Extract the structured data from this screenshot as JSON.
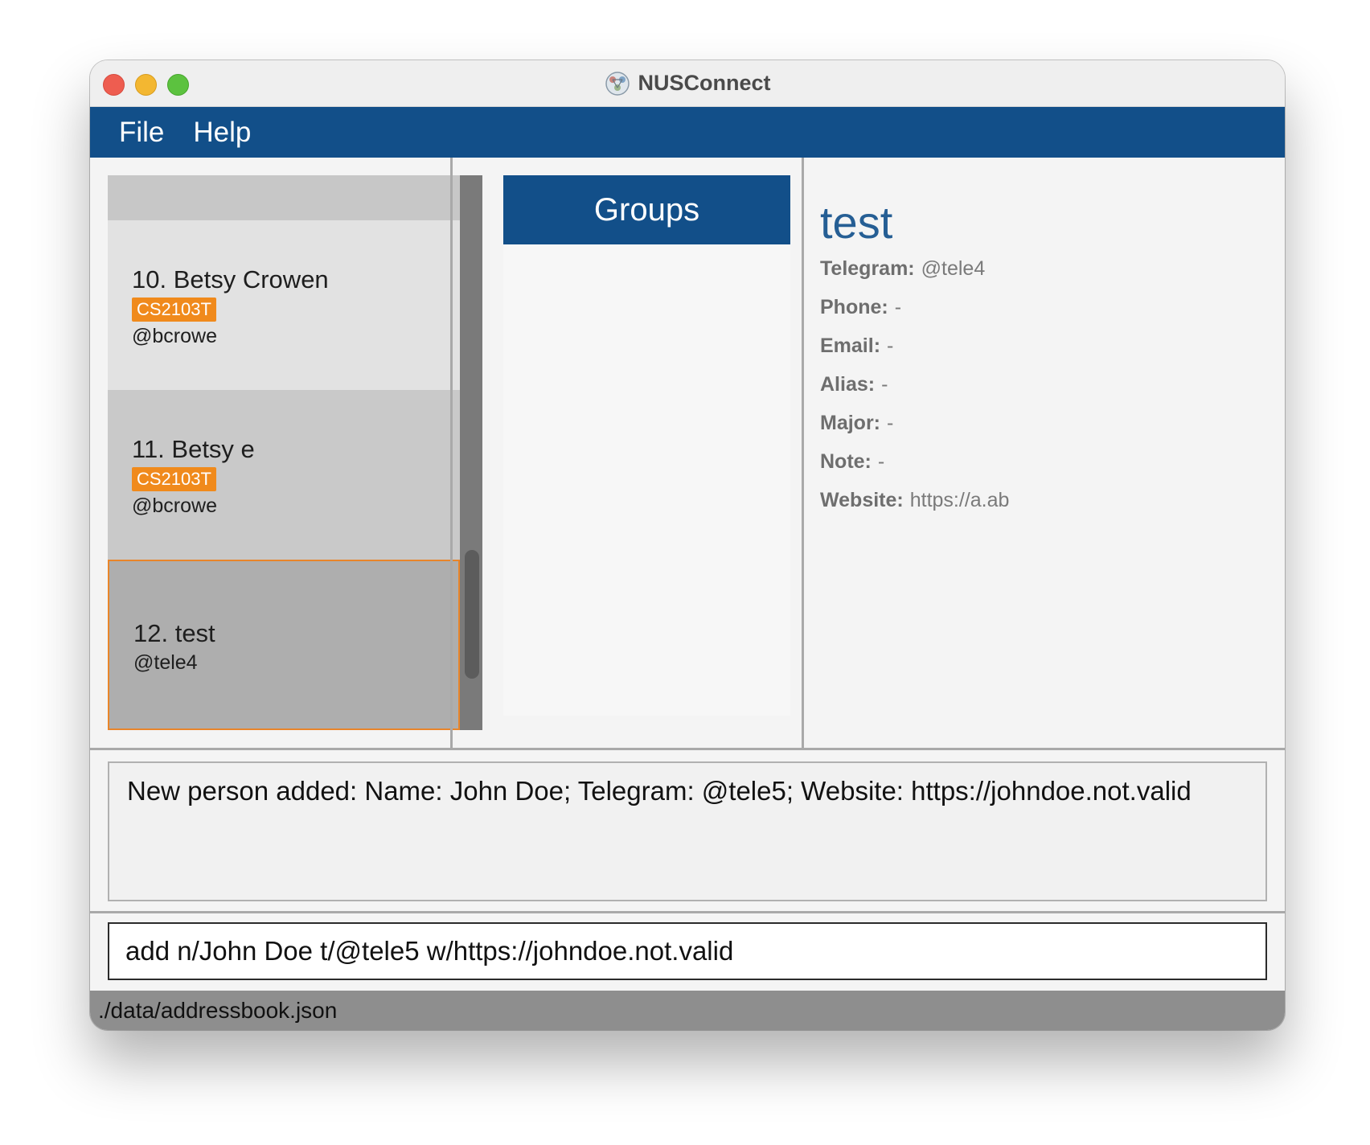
{
  "window": {
    "title": "NUSConnect"
  },
  "menu": {
    "items": [
      "File",
      "Help"
    ]
  },
  "person_list": [
    {
      "name": "10. Betsy Crowen",
      "tag": "CS2103T",
      "handle": "@bcrowe"
    },
    {
      "name": "11. Betsy e",
      "tag": "CS2103T",
      "handle": "@bcrowe"
    },
    {
      "name": "12. test",
      "handle": "@tele4",
      "selected": true
    }
  ],
  "groups": {
    "header": "Groups"
  },
  "details": {
    "name": "test",
    "rows": [
      {
        "label": "Telegram:",
        "value": "@tele4"
      },
      {
        "label": "Phone:",
        "value": "-"
      },
      {
        "label": "Email:",
        "value": "-"
      },
      {
        "label": "Alias:",
        "value": "-"
      },
      {
        "label": "Major:",
        "value": "-"
      },
      {
        "label": "Note:",
        "value": "-"
      },
      {
        "label": "Website:",
        "value": "https://a.ab"
      }
    ]
  },
  "result": {
    "text": "New person added: Name: John Doe; Telegram: @tele5; Website: https://johndoe.not.valid"
  },
  "command": {
    "value": "add n/John Doe t/@tele5 w/https://johndoe.not.valid"
  },
  "status": {
    "path": "./data/addressbook.json"
  },
  "colors": {
    "accent": "#124f89",
    "tag": "#f08a1c",
    "selected_border": "#e9852a",
    "detail_name": "#255e94"
  },
  "icons": {
    "app": "app-logo-icon"
  }
}
